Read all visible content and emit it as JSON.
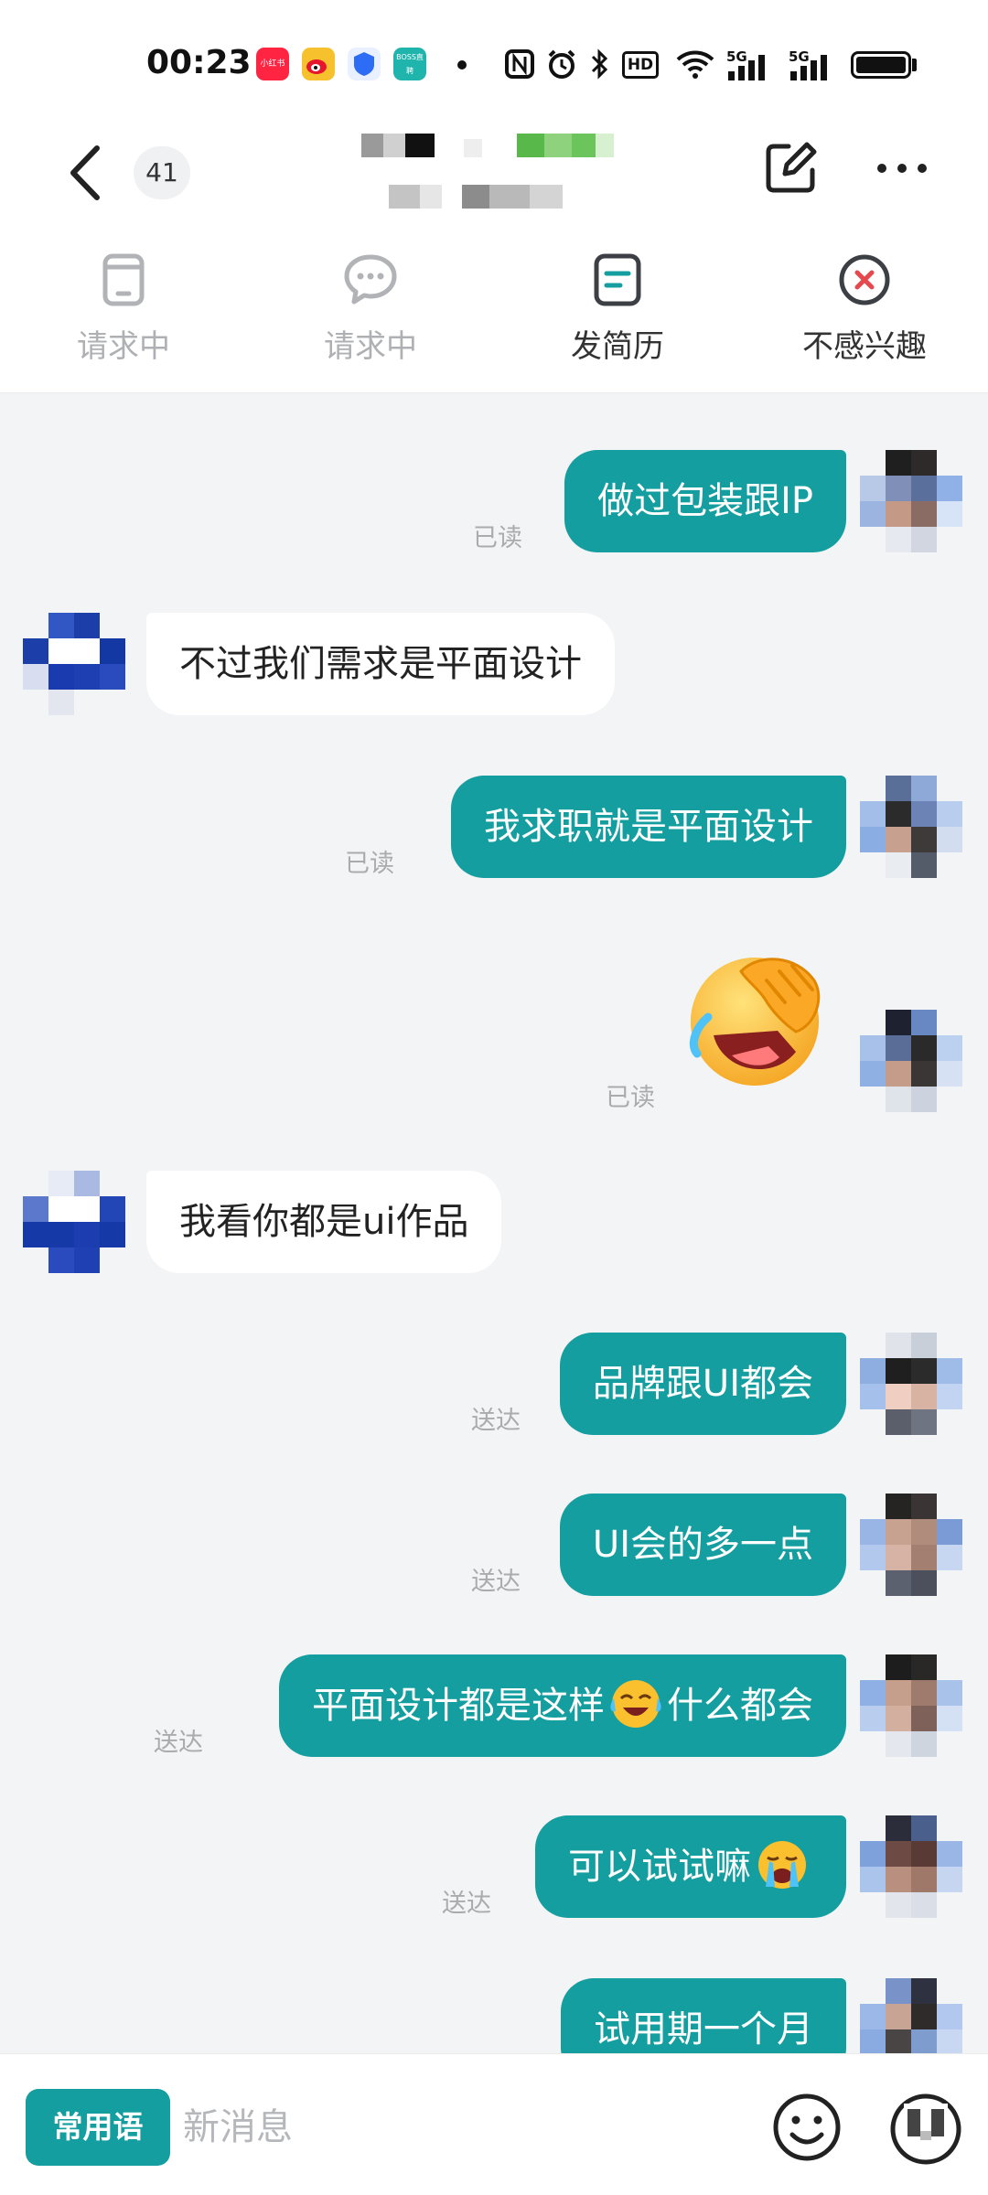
{
  "status_bar": {
    "time": "00:23",
    "app_icons": [
      {
        "name": "xiaohongshu-icon",
        "label": "小红书",
        "color": "#ff2442"
      },
      {
        "name": "weibo-icon",
        "label": "",
        "color": "#f6c12c"
      },
      {
        "name": "shield-app-icon",
        "label": "",
        "color": "#2d6cf5"
      },
      {
        "name": "boss-zhipin-icon",
        "label": "BOSS直聘",
        "color": "#1fb5ad"
      }
    ],
    "network_labels": [
      "5G",
      "5G"
    ],
    "hd_label": "HD"
  },
  "nav": {
    "unread_count": "41"
  },
  "actions": [
    {
      "label": "请求中",
      "icon": "phone-request-icon",
      "state": "disabled"
    },
    {
      "label": "请求中",
      "icon": "wechat-request-icon",
      "state": "disabled"
    },
    {
      "label": "发简历",
      "icon": "resume-icon",
      "state": "enabled"
    },
    {
      "label": "不感兴趣",
      "icon": "not-interested-icon",
      "state": "enabled"
    }
  ],
  "messages": [
    {
      "dir": "out",
      "text": "做过包装跟IP",
      "receipt": "已读"
    },
    {
      "dir": "in",
      "text": "不过我们需求是平面设计"
    },
    {
      "dir": "out",
      "text": "我求职就是平面设计",
      "receipt": "已读"
    },
    {
      "dir": "out",
      "emoji": "facepalm-laugh-emoji",
      "receipt": "已读"
    },
    {
      "dir": "in",
      "text": "我看你都是ui作品"
    },
    {
      "dir": "out",
      "text": "品牌跟UI都会",
      "receipt": "送达"
    },
    {
      "dir": "out",
      "text": "UI会的多一点",
      "receipt": "送达"
    },
    {
      "dir": "out",
      "text_before": "平面设计都是这样",
      "inline_emoji": "tears-of-joy-emoji",
      "text_after": "什么都会",
      "receipt": "送达"
    },
    {
      "dir": "out",
      "text": "可以试试嘛",
      "trailing_emoji": "crying-emoji",
      "receipt": "送达"
    },
    {
      "dir": "out",
      "text": "试用期一个月"
    }
  ],
  "input_bar": {
    "quick_phrases_label": "常用语",
    "placeholder": "新消息"
  },
  "colors": {
    "accent": "#149ea0",
    "chat_background": "#f3f4f6",
    "receipt_gray": "#a9abae",
    "disabled_gray": "#aeb0b3"
  }
}
